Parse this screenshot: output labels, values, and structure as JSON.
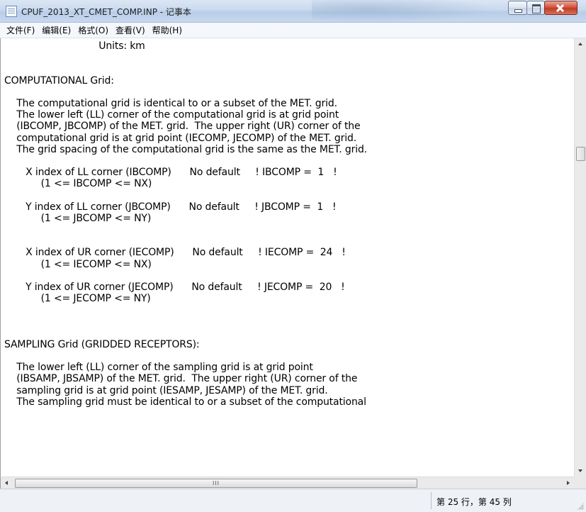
{
  "window": {
    "title": "CPUF_2013_XT_CMET_COMP.INP - 记事本"
  },
  "menu": [
    {
      "label": "文件(F)"
    },
    {
      "label": "编辑(E)"
    },
    {
      "label": "格式(O)"
    },
    {
      "label": "查看(V)"
    },
    {
      "label": "帮助(H)"
    }
  ],
  "editor": {
    "lines": [
      "                               Units: km",
      "",
      "",
      "COMPUTATIONAL Grid:",
      "",
      "    The computational grid is identical to or a subset of the MET. grid.",
      "    The lower left (LL) corner of the computational grid is at grid point",
      "    (IBCOMP, JBCOMP) of the MET. grid.  The upper right (UR) corner of the",
      "    computational grid is at grid point (IECOMP, JECOMP) of the MET. grid.",
      "    The grid spacing of the computational grid is the same as the MET. grid.",
      "",
      "       X index of LL corner (IBCOMP)      No default     ! IBCOMP =  1   !",
      "            (1 <= IBCOMP <= NX)",
      "",
      "       Y index of LL corner (JBCOMP)      No default     ! JBCOMP =  1   !",
      "            (1 <= JBCOMP <= NY)",
      "",
      "",
      "       X index of UR corner (IECOMP)      No default     ! IECOMP =  24   !",
      "            (1 <= IECOMP <= NX)",
      "",
      "       Y index of UR corner (JECOMP)      No default     ! JECOMP =  20   !",
      "            (1 <= JECOMP <= NY)",
      "",
      "",
      "",
      "SAMPLING Grid (GRIDDED RECEPTORS):",
      "",
      "    The lower left (LL) corner of the sampling grid is at grid point",
      "    (IBSAMP, JBSAMP) of the MET. grid.  The upper right (UR) corner of the",
      "    sampling grid is at grid point (IESAMP, JESAMP) of the MET. grid.",
      "    The sampling grid must be identical to or a subset of the computational"
    ]
  },
  "scrollbar": {
    "hscroll_grip": "III"
  },
  "status": {
    "position": "第 25 行，第 45 列"
  }
}
